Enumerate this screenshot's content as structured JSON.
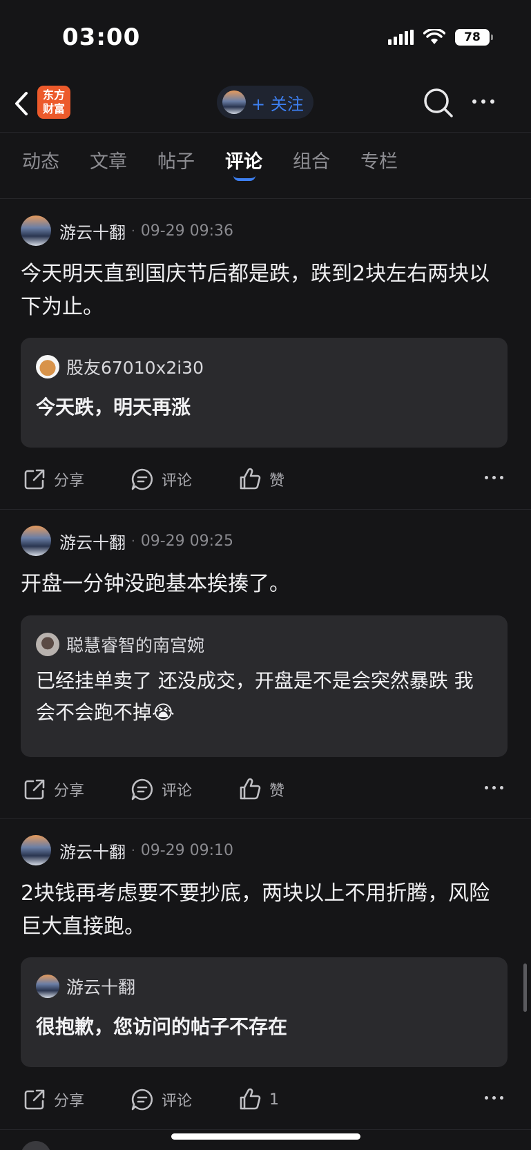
{
  "status": {
    "time": "03:00",
    "battery": "78"
  },
  "nav": {
    "logo_line1": "东方",
    "logo_line2": "财富",
    "follow": "+ 关注"
  },
  "tabs": [
    {
      "label": "动态"
    },
    {
      "label": "文章"
    },
    {
      "label": "帖子"
    },
    {
      "label": "评论"
    },
    {
      "label": "组合"
    },
    {
      "label": "专栏"
    }
  ],
  "active_tab": "评论",
  "posts": [
    {
      "author": "游云十翻",
      "time": "09-29 09:36",
      "body": "今天明天直到国庆节后都是跌，跌到2块左右两块以下为止。",
      "quote_author": "股友67010x2i30",
      "quote_text": "今天跌，明天再涨",
      "share": "分享",
      "comment": "评论",
      "like": "赞"
    },
    {
      "author": "游云十翻",
      "time": "09-29 09:25",
      "body": "开盘一分钟没跑基本挨揍了。",
      "quote_author": "聪慧睿智的南宫婉",
      "quote_text": "已经挂单卖了 还没成交，开盘是不是会突然暴跌 我会不会跑不掉😭",
      "share": "分享",
      "comment": "评论",
      "like": "赞"
    },
    {
      "author": "游云十翻",
      "time": "09-29 09:10",
      "body": "2块钱再考虑要不要抄底，两块以上不用折腾，风险巨大直接跑。",
      "quote_author": "游云十翻",
      "quote_text": "很抱歉，您访问的帖子不存在",
      "share": "分享",
      "comment": "评论",
      "like": "1"
    }
  ],
  "colors": {
    "background": "#151517",
    "accent": "#3d7ff0",
    "card": "#2a2a2d",
    "logo": "#ec5a2b"
  }
}
